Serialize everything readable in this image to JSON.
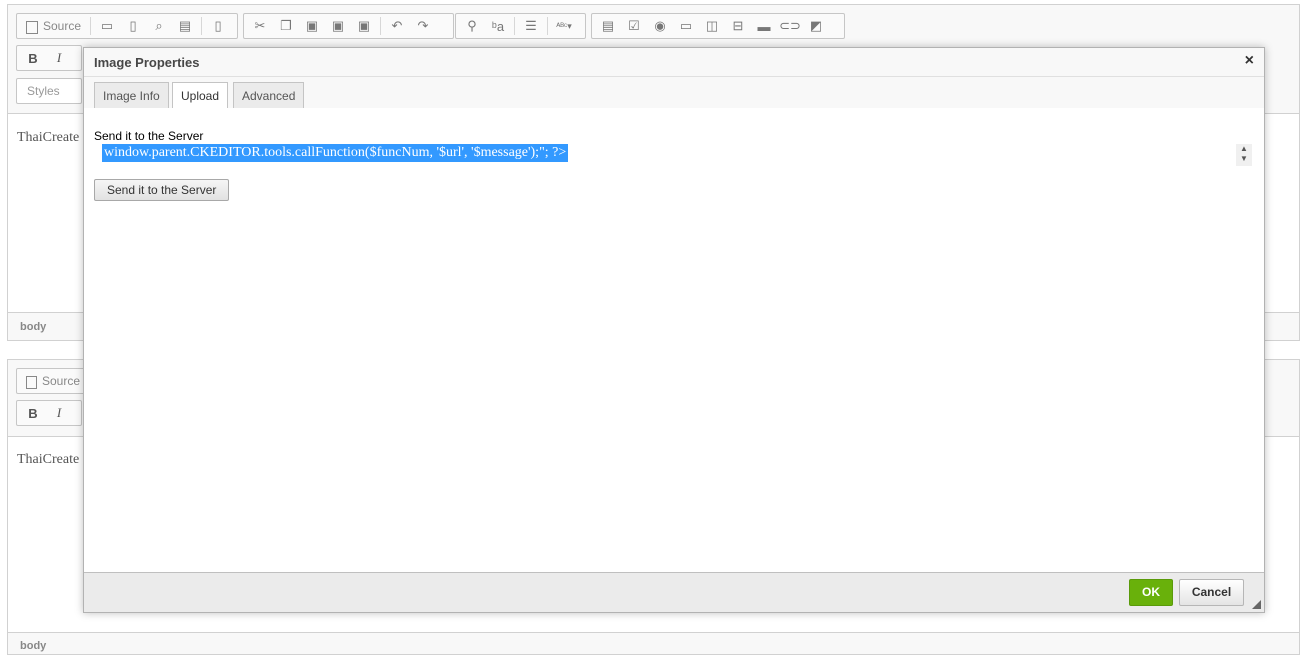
{
  "editor1": {
    "toolbar": {
      "source_label": "Source",
      "bold_label": "B",
      "italic_label": "I",
      "styles_placeholder": "Styles"
    },
    "content_text": "ThaiCreate",
    "status_path": "body"
  },
  "editor2": {
    "toolbar": {
      "source_label": "Source",
      "bold_label": "B",
      "italic_label": "I"
    },
    "content_text": "ThaiCreate",
    "status_path": "body"
  },
  "dialog": {
    "title": "Image Properties",
    "close_glyph": "×",
    "tabs": [
      {
        "label": "Image Info",
        "active": false
      },
      {
        "label": "Upload",
        "active": true
      },
      {
        "label": "Advanced",
        "active": false
      }
    ],
    "upload": {
      "field_label": "Send it to the Server",
      "file_value": "window.parent.CKEDITOR.tools.callFunction($funcNum, '$url', '$message');\"; ?>",
      "send_button_label": "Send it to the Server"
    },
    "footer": {
      "ok_label": "OK",
      "cancel_label": "Cancel"
    }
  },
  "colors": {
    "ok_green": "#69b10b",
    "selection_blue": "#3399ff"
  }
}
